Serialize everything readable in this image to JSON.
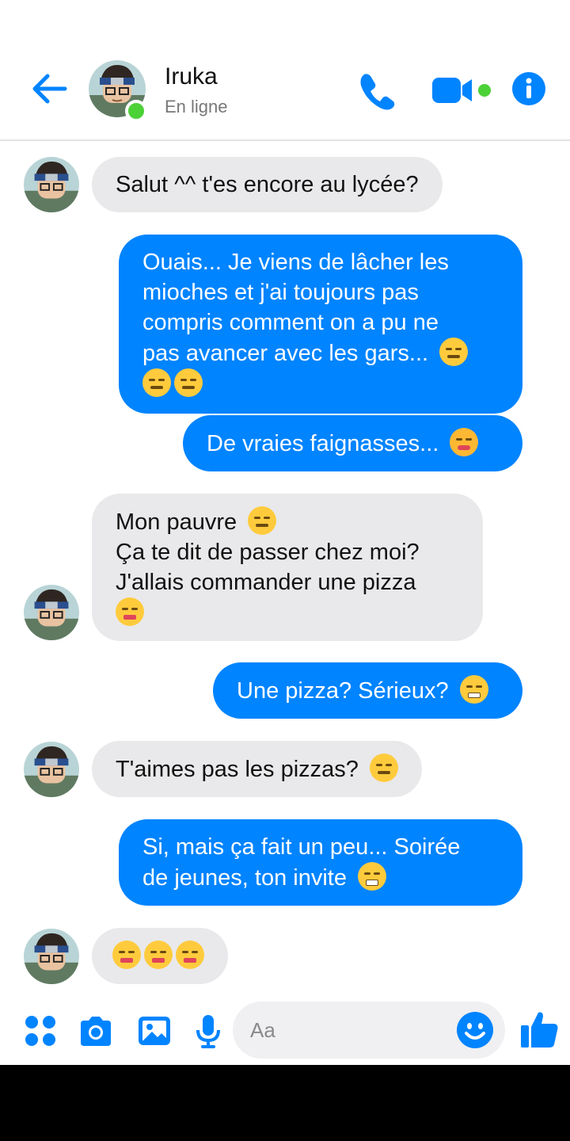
{
  "header": {
    "contact_name": "Iruka",
    "status": "En ligne",
    "icons": [
      "back-arrow-icon",
      "phone-icon",
      "video-camera-icon",
      "info-icon"
    ]
  },
  "messages": [
    {
      "direction": "in",
      "text": "Salut ^^ t'es encore au lycée?"
    },
    {
      "direction": "out",
      "text": "Ouais... Je viens de lâcher les\nmioches et j'ai toujours pas\ncompris comment on a pu ne\npas avancer avec les gars...",
      "emoji": [
        "expressionless-face",
        "expressionless-face",
        "expressionless-face"
      ]
    },
    {
      "direction": "out",
      "text": "De vraies faignasses...",
      "emoji": [
        "flushed-face"
      ]
    },
    {
      "direction": "in",
      "text": "Mon pauvre",
      "text2": "Ça te dit de passer chez moi?\nJ'allais commander une pizza",
      "emoji": [
        "smiling-face",
        "yum-face"
      ]
    },
    {
      "direction": "out",
      "text": "Une pizza? Sérieux?",
      "emoji": [
        "grimacing-face"
      ]
    },
    {
      "direction": "in",
      "text": "T'aimes pas les pizzas?",
      "emoji": [
        "smiling-face"
      ]
    },
    {
      "direction": "out",
      "text": "Si, mais ça fait un peu... Soirée\nde jeunes, ton invite",
      "emoji": [
        "laughing-face"
      ]
    },
    {
      "direction": "in",
      "text": "",
      "emoji": [
        "squinting-tongue-face",
        "squinting-tongue-face",
        "squinting-tongue-face"
      ]
    }
  ],
  "composer": {
    "placeholder": "Aa",
    "icons": [
      "apps-icon",
      "camera-icon",
      "gallery-icon",
      "microphone-icon",
      "emoji-icon",
      "thumbs-up-icon"
    ]
  },
  "colors": {
    "accent": "#0084ff",
    "incoming_bubble": "#e9e9eb",
    "online": "#4cd137"
  }
}
